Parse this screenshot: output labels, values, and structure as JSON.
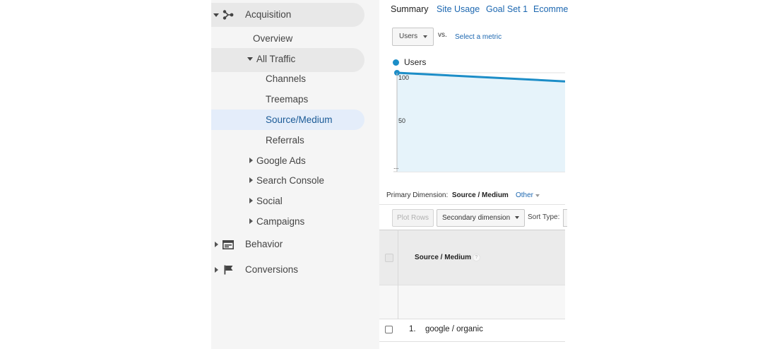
{
  "sidebar": {
    "acquisition": {
      "label": "Acquisition",
      "icon": "acquisition-icon"
    },
    "overview": "Overview",
    "all_traffic": "All Traffic",
    "channels": "Channels",
    "treemaps": "Treemaps",
    "source_medium": "Source/Medium",
    "referrals": "Referrals",
    "google_ads": "Google Ads",
    "search_console": "Search Console",
    "social": "Social",
    "campaigns": "Campaigns",
    "behavior": {
      "label": "Behavior",
      "icon": "behavior-icon"
    },
    "conversions": {
      "label": "Conversions",
      "icon": "flag-icon"
    }
  },
  "tabs": [
    "Summary",
    "Site Usage",
    "Goal Set 1",
    "Ecomme"
  ],
  "metric_selector": {
    "selected": "Users",
    "vs": "vs.",
    "select_metric": "Select a metric"
  },
  "chart_data": {
    "type": "line",
    "series": [
      {
        "name": "Users",
        "values": [
          100,
          90
        ]
      }
    ],
    "yticks": [
      "100",
      "50"
    ],
    "x_tick_truncated": "...",
    "ylim": [
      0,
      100
    ],
    "color": "#1c8dc7"
  },
  "table": {
    "primary_dimension_label": "Primary Dimension:",
    "primary_dimension_value": "Source / Medium",
    "other": "Other",
    "plot_rows": "Plot Rows",
    "secondary_dimension": "Secondary dimension",
    "sort_type": "Sort Type:",
    "column_header": "Source / Medium",
    "help": "?",
    "rows": [
      {
        "index": "1.",
        "value": "google / organic"
      }
    ]
  }
}
